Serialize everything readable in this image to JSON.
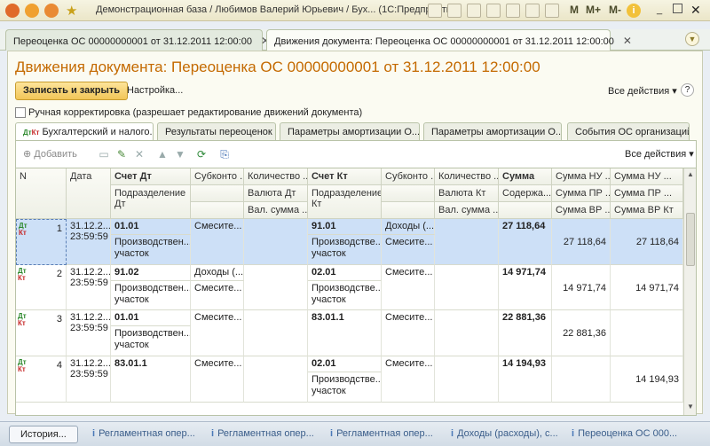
{
  "window": {
    "title": "Демонстрационная база / Любимов Валерий Юрьевич / Бух... (1С:Предприятие)",
    "toolbar_letters": [
      "M",
      "M+",
      "M-"
    ]
  },
  "doc_tabs": [
    {
      "label": "Переоценка ОС 00000000001 от 31.12.2011 12:00:00"
    },
    {
      "label": "Движения документа: Переоценка ОС 00000000001 от 31.12.2011 12:00:00"
    }
  ],
  "form": {
    "title": "Движения документа: Переоценка ОС 00000000001 от 31.12.2011 12:00:00",
    "save_close_label": "Записать и закрыть",
    "settings_label": "Настройка...",
    "all_actions_label": "Все действия ▾",
    "manual_adjust_label": "Ручная корректировка (разрешает редактирование движений документа)"
  },
  "sub_tabs": [
    {
      "label": "Бухгалтерский и налого..."
    },
    {
      "label": "Результаты переоценок"
    },
    {
      "label": "Параметры амортизации О..."
    },
    {
      "label": "Параметры амортизации О..."
    },
    {
      "label": "События ОС организаций"
    }
  ],
  "toolbar": {
    "add_label": "Добавить",
    "all_actions_label": "Все действия ▾"
  },
  "table": {
    "headers": {
      "n": "N",
      "date": "Дата",
      "account_dt": "Счет Дт",
      "subconto_dt": "Субконто ...",
      "quantity_dt": "Количество ...",
      "account_kt": "Счет Кт",
      "subconto_kt": "Субконто ...",
      "quantity_kt": "Количество ...",
      "sum": "Сумма",
      "sum_nu_dt": "Сумма НУ ...",
      "sum_nu_kt": "Сумма НУ ...",
      "dept_dt": "Подразделение Дт",
      "currency_dt": "Валюта Дт",
      "cur_sum_dt": "Вал. сумма ...",
      "dept_kt": "Подразделение Кт",
      "currency_kt": "Валюта Кт",
      "cur_sum_kt": "Вал. сумма ...",
      "content": "Содержа...",
      "sum_pr_dt": "Сумма ПР ...",
      "sum_pr_kt": "Сумма ПР ...",
      "sum_vr_dt": "Сумма ВР ...",
      "sum_vr_kt": "Сумма ВР Кт"
    },
    "dt_label": "Дт",
    "kt_label": "Кт",
    "rows": [
      {
        "n": "1",
        "date": "31.12.2...",
        "time": "23:59:59",
        "account_dt": "01.01",
        "dept_dt": "Производствен... участок",
        "subconto_dt": "Смесите...",
        "account_kt": "91.01",
        "subconto_kt": "Доходы (...",
        "dept_kt": "Производстве... участок",
        "subconto_kt2": "Смесите...",
        "sum": "27 118,64",
        "sum_vr_dt": "27 118,64",
        "sum_vr_kt": "27 118,64"
      },
      {
        "n": "2",
        "date": "31.12.2...",
        "time": "23:59:59",
        "account_dt": "91.02",
        "dept_dt": "Производствен... участок",
        "subconto_dt": "Доходы (...",
        "subconto_dt2": "Смесите...",
        "account_kt": "02.01",
        "subconto_kt": "Смесите...",
        "dept_kt": "Производстве... участок",
        "sum": "14 971,74",
        "sum_vr_dt": "14 971,74",
        "sum_vr_kt": "14 971,74"
      },
      {
        "n": "3",
        "date": "31.12.2...",
        "time": "23:59:59",
        "account_dt": "01.01",
        "dept_dt": "Производствен... участок",
        "subconto_dt": "Смесите...",
        "account_kt": "83.01.1",
        "subconto_kt": "Смесите...",
        "sum": "22 881,36",
        "sum_vr_dt": "22 881,36"
      },
      {
        "n": "4",
        "date": "31.12.2...",
        "time": "23:59:59",
        "account_dt": "83.01.1",
        "subconto_dt": "Смесите...",
        "account_kt": "02.01",
        "subconto_kt": "Смесите...",
        "dept_kt": "Производстве... участок",
        "sum": "14 194,93",
        "sum_vr_kt": "14 194,93"
      }
    ]
  },
  "taskbar": [
    {
      "label": "История..."
    },
    {
      "label": "Регламентная опер..."
    },
    {
      "label": "Регламентная опер..."
    },
    {
      "label": "Регламентная опер..."
    },
    {
      "label": "Доходы (расходы), с..."
    },
    {
      "label": "Переоценка ОС 000..."
    }
  ]
}
